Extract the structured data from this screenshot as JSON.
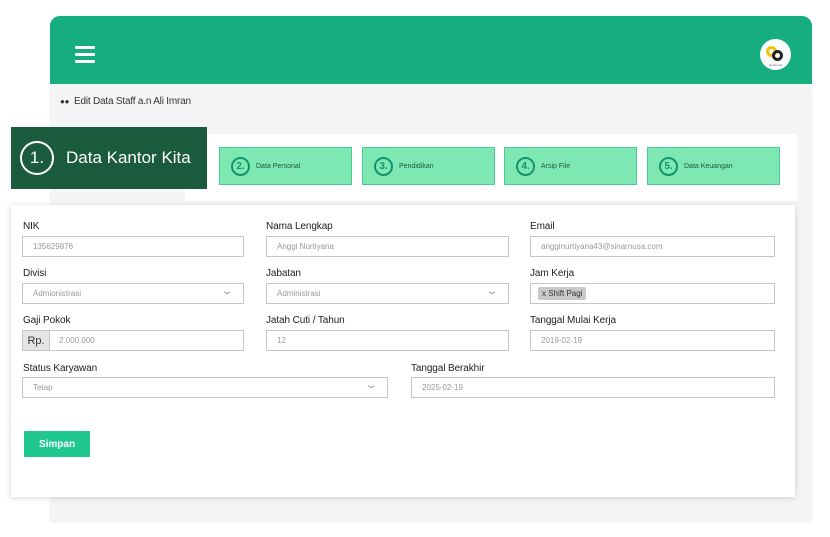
{
  "header": {
    "menu_icon": "hamburger-icon",
    "logo_text": "sinarnusa"
  },
  "page": {
    "title": "Edit Data Staff a.n Ali Imran",
    "title_icon": "users-icon"
  },
  "steps": [
    {
      "num": "1.",
      "label": "Data Kantor Kita",
      "active": true
    },
    {
      "num": "2.",
      "label": "Data Personal"
    },
    {
      "num": "3.",
      "label": "Pendidikan"
    },
    {
      "num": "4.",
      "label": "Arsip File"
    },
    {
      "num": "5.",
      "label": "Data Keuangan"
    }
  ],
  "form": {
    "nik": {
      "label": "NIK",
      "value": "135629876"
    },
    "nama": {
      "label": "Nama Lengkap",
      "value": "Anggi Nurtiyana"
    },
    "email": {
      "label": "Email",
      "value": "angginurtiyana43@sinarnusa.com"
    },
    "divisi": {
      "label": "Divisi",
      "value": "Admionistrasi"
    },
    "jabatan": {
      "label": "Jabatan",
      "value": "Administrasi"
    },
    "jam_kerja": {
      "label": "Jam Kerja",
      "tag": "x Shift Pagi"
    },
    "gaji": {
      "label": "Gaji Pokok",
      "prefix": "Rp.",
      "value": "2.000.000"
    },
    "cuti": {
      "label": "Jatah Cuti / Tahun",
      "value": "12"
    },
    "tgl_mulai": {
      "label": "Tanggal Mulai Kerja",
      "value": "2019-02-19"
    },
    "status": {
      "label": "Status Karyawan",
      "value": "Tetap"
    },
    "tgl_akhir": {
      "label": "Tanggal Berakhir",
      "value": "2025-02-19"
    },
    "save_label": "Simpan"
  },
  "colors": {
    "primary": "#16ad7f",
    "active_step": "#1b5b3d",
    "step_bg": "#7ee8b3",
    "button": "#20c88f"
  }
}
